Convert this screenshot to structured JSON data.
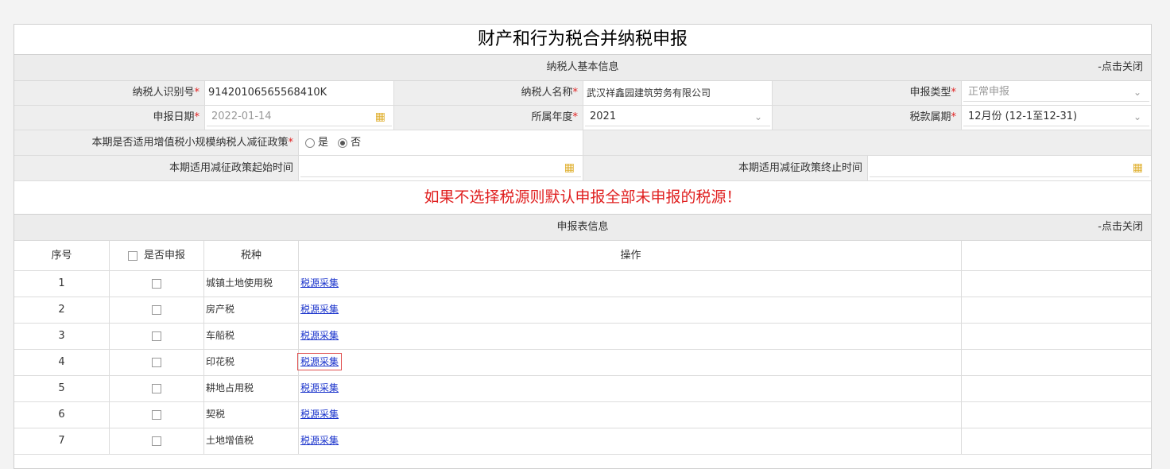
{
  "title": "财产和行为税合并纳税申报",
  "basic": {
    "header": "纳税人基本信息",
    "close_label": "-点击关闭",
    "taxpayer_id_label": "纳税人识别号",
    "taxpayer_id_value": "91420106565568410K",
    "taxpayer_name_label": "纳税人名称",
    "taxpayer_name_value": "武汉祥鑫园建筑劳务有限公司",
    "decl_type_label": "申报类型",
    "decl_type_value": "正常申报",
    "decl_date_label": "申报日期",
    "decl_date_value": "2022-01-14",
    "year_label": "所属年度",
    "year_value": "2021",
    "period_label": "税款属期",
    "period_value": "12月份 (12-1至12-31)",
    "policy_label": "本期是否适用增值税小规模纳税人减征政策",
    "policy_yes": "是",
    "policy_no": "否",
    "policy_start_label": "本期适用减征政策起始时间",
    "policy_end_label": "本期适用减征政策终止时间",
    "required_mark": "*"
  },
  "warning": "如果不选择税源则默认申报全部未申报的税源！",
  "table": {
    "header": "申报表信息",
    "close_label": "-点击关闭",
    "col_index": "序号",
    "col_declare": "是否申报",
    "col_tax": "税种",
    "col_op": "操作",
    "rows": [
      {
        "index": "1",
        "tax": "城镇土地使用税",
        "op": "税源采集"
      },
      {
        "index": "2",
        "tax": "房产税",
        "op": "税源采集"
      },
      {
        "index": "3",
        "tax": "车船税",
        "op": "税源采集"
      },
      {
        "index": "4",
        "tax": "印花税",
        "op": "税源采集"
      },
      {
        "index": "5",
        "tax": "耕地占用税",
        "op": "税源采集"
      },
      {
        "index": "6",
        "tax": "契税",
        "op": "税源采集"
      },
      {
        "index": "7",
        "tax": "土地增值税",
        "op": "税源采集"
      }
    ]
  },
  "icons": {
    "dropdown": "chevron-down-icon",
    "calendar": "calendar-icon"
  },
  "colors": {
    "required": "#e02020",
    "warning": "#e02020",
    "link": "#1a33cc",
    "highlight": "#e05050"
  }
}
